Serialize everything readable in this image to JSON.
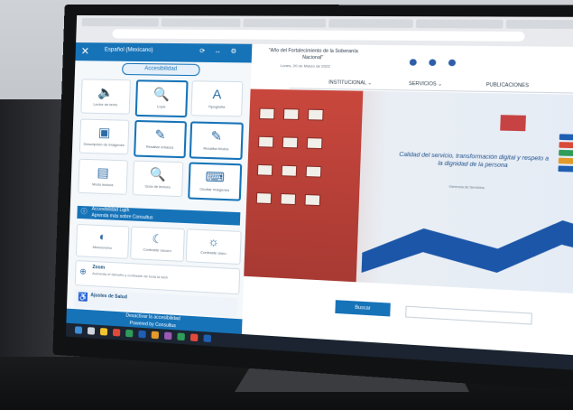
{
  "panel": {
    "title": "Español (Mexicano)",
    "header_icons": "⟳ ↔ ⚙",
    "accesibilidad": "Accesibilidad",
    "cards": [
      {
        "label": "Lector de texto",
        "icon": "speaker-icon"
      },
      {
        "label": "Lupa",
        "icon": "magnifier-icon"
      },
      {
        "label": "Tipografía",
        "icon": "font-icon"
      },
      {
        "label": "Descripción de imágenes",
        "icon": "image-icon"
      },
      {
        "label": "Resaltar enlaces",
        "icon": "link-icon"
      },
      {
        "label": "Resaltar títulos",
        "icon": "heading-icon"
      },
      {
        "label": "Modo lectura",
        "icon": "reader-icon"
      },
      {
        "label": "Guía de lectura",
        "icon": "guide-icon"
      },
      {
        "label": "Ocultar imágenes",
        "icon": "keyboard-icon"
      }
    ],
    "banner_line1": "Accesibilidad Ligth",
    "banner_line2": "Aprenda más sobre Consultus",
    "row": [
      {
        "label": "Monocromo",
        "icon": "contrast-icon"
      },
      {
        "label": "Contraste oscuro",
        "icon": "moon-icon"
      },
      {
        "label": "Contraste claro",
        "icon": "sun-icon"
      }
    ],
    "zoom_title": "Zoom",
    "zoom_desc": "Aumenta el tamaño y contraste de toda la web",
    "ajuste_title": "Ajustes de Salud",
    "footer_line1": "Desactivar la accesibilidad",
    "footer_line2": "Powered by Consultus"
  },
  "site": {
    "title": "\"Año del Fortalecimiento de la Soberanía Nacional\"",
    "date": "Lunes, 20 de Marzo de 2022",
    "menu": [
      "INSTITUCIONAL ⌄",
      "SERVICIOS ⌄",
      "PUBLICACIONES"
    ],
    "hero_text": "Calidad del servicio, transformación digital y respeto a la dignidad de la persona",
    "hero_sub": "Gerencia de Servicios",
    "button": "Buscar"
  },
  "colors": {
    "accent": "#1673b8",
    "brand_red": "#c9473d",
    "wave": "#1c56a8"
  }
}
